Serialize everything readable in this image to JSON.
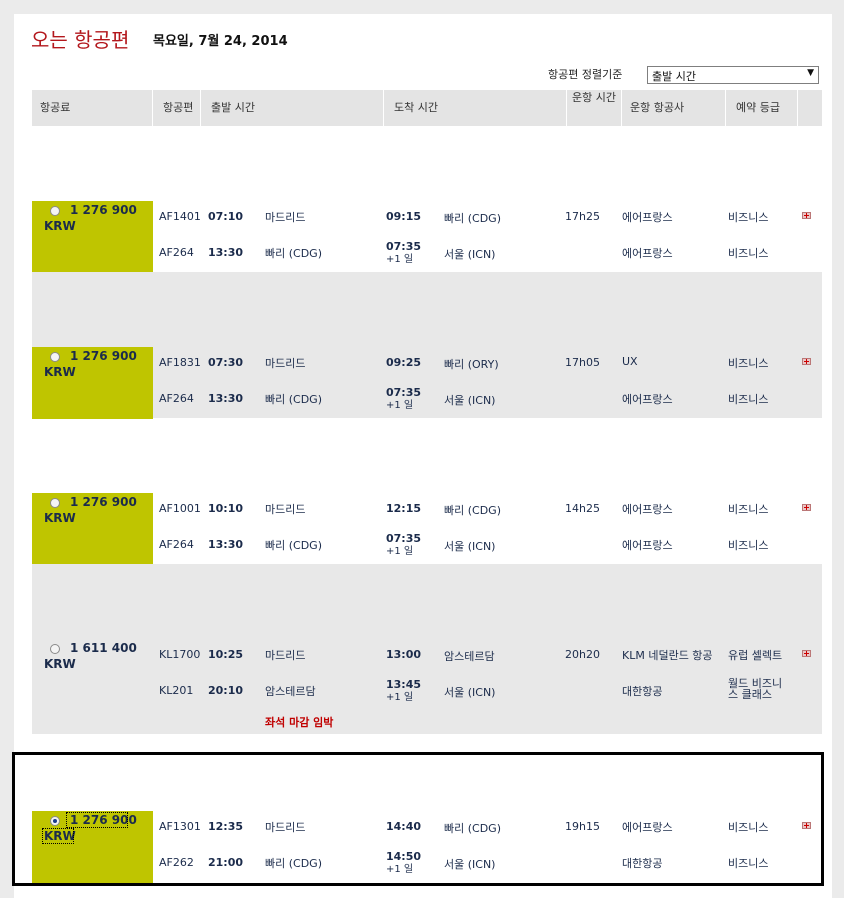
{
  "page": {
    "title": "오는 항공편",
    "date": "목요일, 7월 24, 2014",
    "sort_label": "항공편 정렬기준",
    "sort_value": "출발 시간"
  },
  "header": {
    "fare": "항공료",
    "flight": "항공편",
    "departure": "출발 시간",
    "arrival": "도착 시간",
    "duration": "운항 시간",
    "airline": "운항 항공사",
    "class": "예약 등급"
  },
  "options": [
    {
      "price": "1 276 900",
      "currency": "KRW",
      "selected": false,
      "legs": [
        {
          "flight": "AF1401",
          "dep_time": "07:10",
          "dep_city": "마드리드",
          "arr_time": "09:15",
          "arr_offset": "",
          "arr_city": "빠리 (CDG)",
          "duration": "17h25",
          "airline": "에어프랑스",
          "class": "비즈니스"
        },
        {
          "flight": "AF264",
          "dep_time": "13:30",
          "dep_city": "빠리 (CDG)",
          "arr_time": "07:35",
          "arr_offset": "+1 일",
          "arr_city": "서울 (ICN)",
          "duration": "",
          "airline": "에어프랑스",
          "class": "비즈니스"
        }
      ]
    },
    {
      "price": "1 276 900",
      "currency": "KRW",
      "selected": false,
      "legs": [
        {
          "flight": "AF1831",
          "dep_time": "07:30",
          "dep_city": "마드리드",
          "arr_time": "09:25",
          "arr_offset": "",
          "arr_city": "빠리 (ORY)",
          "duration": "17h05",
          "airline": "UX",
          "class": "비즈니스"
        },
        {
          "flight": "AF264",
          "dep_time": "13:30",
          "dep_city": "빠리 (CDG)",
          "arr_time": "07:35",
          "arr_offset": "+1 일",
          "arr_city": "서울 (ICN)",
          "duration": "",
          "airline": "에어프랑스",
          "class": "비즈니스"
        }
      ]
    },
    {
      "price": "1 276 900",
      "currency": "KRW",
      "selected": false,
      "legs": [
        {
          "flight": "AF1001",
          "dep_time": "10:10",
          "dep_city": "마드리드",
          "arr_time": "12:15",
          "arr_offset": "",
          "arr_city": "빠리 (CDG)",
          "duration": "14h25",
          "airline": "에어프랑스",
          "class": "비즈니스"
        },
        {
          "flight": "AF264",
          "dep_time": "13:30",
          "dep_city": "빠리 (CDG)",
          "arr_time": "07:35",
          "arr_offset": "+1 일",
          "arr_city": "서울 (ICN)",
          "duration": "",
          "airline": "에어프랑스",
          "class": "비즈니스"
        }
      ]
    },
    {
      "price": "1 611 400",
      "currency": "KRW",
      "selected": false,
      "warning": "좌석 마감 임박",
      "legs": [
        {
          "flight": "KL1700",
          "dep_time": "10:25",
          "dep_city": "마드리드",
          "arr_time": "13:00",
          "arr_offset": "",
          "arr_city": "암스테르담",
          "duration": "20h20",
          "airline": "KLM 네덜란드 항공",
          "class": "유럽 셀렉트"
        },
        {
          "flight": "KL201",
          "dep_time": "20:10",
          "dep_city": "암스테르담",
          "arr_time": "13:45",
          "arr_offset": "+1 일",
          "arr_city": "서울 (ICN)",
          "duration": "",
          "airline": "대한항공",
          "class": "월드 비즈니스 클래스"
        }
      ]
    },
    {
      "price": "1 276 900",
      "currency": "KRW",
      "selected": true,
      "legs": [
        {
          "flight": "AF1301",
          "dep_time": "12:35",
          "dep_city": "마드리드",
          "arr_time": "14:40",
          "arr_offset": "",
          "arr_city": "빠리 (CDG)",
          "duration": "19h15",
          "airline": "에어프랑스",
          "class": "비즈니스"
        },
        {
          "flight": "AF262",
          "dep_time": "21:00",
          "dep_city": "빠리 (CDG)",
          "arr_time": "14:50",
          "arr_offset": "+1 일",
          "arr_city": "서울 (ICN)",
          "duration": "",
          "airline": "대한항공",
          "class": "비즈니스"
        }
      ]
    }
  ]
}
